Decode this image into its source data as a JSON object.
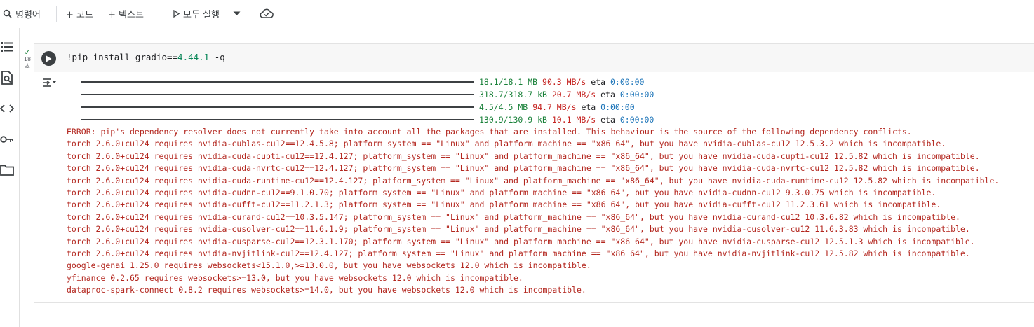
{
  "toolbar": {
    "commands_label": "명령어",
    "add_code_label": "+ 코드",
    "add_text_label": "+ 텍스트",
    "run_all_label": "모두 실행"
  },
  "cell": {
    "exec_time": "18",
    "exec_unit": "초",
    "code_prefix": "!pip install gradio==",
    "code_version": "4.44.1",
    "code_suffix": " -q"
  },
  "progress": [
    {
      "size": "18.1/18.1 MB",
      "rate": "90.3 MB/s",
      "eta_label": "eta",
      "eta": "0:00:00"
    },
    {
      "size": "318.7/318.7 kB",
      "rate": "20.7 MB/s",
      "eta_label": "eta",
      "eta": "0:00:00"
    },
    {
      "size": "4.5/4.5 MB",
      "rate": "94.7 MB/s",
      "eta_label": "eta",
      "eta": "0:00:00"
    },
    {
      "size": "130.9/130.9 kB",
      "rate": "10.1 MB/s",
      "eta_label": "eta",
      "eta": "0:00:00"
    }
  ],
  "output_lines": [
    "ERROR: pip's dependency resolver does not currently take into account all the packages that are installed. This behaviour is the source of the following dependency conflicts.",
    "torch 2.6.0+cu124 requires nvidia-cublas-cu12==12.4.5.8; platform_system == \"Linux\" and platform_machine == \"x86_64\", but you have nvidia-cublas-cu12 12.5.3.2 which is incompatible.",
    "torch 2.6.0+cu124 requires nvidia-cuda-cupti-cu12==12.4.127; platform_system == \"Linux\" and platform_machine == \"x86_64\", but you have nvidia-cuda-cupti-cu12 12.5.82 which is incompatible.",
    "torch 2.6.0+cu124 requires nvidia-cuda-nvrtc-cu12==12.4.127; platform_system == \"Linux\" and platform_machine == \"x86_64\", but you have nvidia-cuda-nvrtc-cu12 12.5.82 which is incompatible.",
    "torch 2.6.0+cu124 requires nvidia-cuda-runtime-cu12==12.4.127; platform_system == \"Linux\" and platform_machine == \"x86_64\", but you have nvidia-cuda-runtime-cu12 12.5.82 which is incompatible.",
    "torch 2.6.0+cu124 requires nvidia-cudnn-cu12==9.1.0.70; platform_system == \"Linux\" and platform_machine == \"x86_64\", but you have nvidia-cudnn-cu12 9.3.0.75 which is incompatible.",
    "torch 2.6.0+cu124 requires nvidia-cufft-cu12==11.2.1.3; platform_system == \"Linux\" and platform_machine == \"x86_64\", but you have nvidia-cufft-cu12 11.2.3.61 which is incompatible.",
    "torch 2.6.0+cu124 requires nvidia-curand-cu12==10.3.5.147; platform_system == \"Linux\" and platform_machine == \"x86_64\", but you have nvidia-curand-cu12 10.3.6.82 which is incompatible.",
    "torch 2.6.0+cu124 requires nvidia-cusolver-cu12==11.6.1.9; platform_system == \"Linux\" and platform_machine == \"x86_64\", but you have nvidia-cusolver-cu12 11.6.3.83 which is incompatible.",
    "torch 2.6.0+cu124 requires nvidia-cusparse-cu12==12.3.1.170; platform_system == \"Linux\" and platform_machine == \"x86_64\", but you have nvidia-cusparse-cu12 12.5.1.3 which is incompatible.",
    "torch 2.6.0+cu124 requires nvidia-nvjitlink-cu12==12.4.127; platform_system == \"Linux\" and platform_machine == \"x86_64\", but you have nvidia-nvjitlink-cu12 12.5.82 which is incompatible.",
    "google-genai 1.25.0 requires websockets<15.1.0,>=13.0.0, but you have websockets 12.0 which is incompatible.",
    "yfinance 0.2.65 requires websockets>=13.0, but you have websockets 12.0 which is incompatible.",
    "dataproc-spark-connect 0.8.2 requires websockets>=14.0, but you have websockets 12.0 which is incompatible."
  ],
  "colors": {
    "error_text": "#b3261e",
    "progress_size": "#188038",
    "progress_eta": "#1a73b8",
    "code_version": "#098658"
  },
  "icons": [
    "search-icon",
    "plus-icon",
    "play-icon",
    "chevron-down-icon",
    "cloud-icon",
    "toc-icon",
    "find-replace-icon",
    "code-brackets-icon",
    "key-icon",
    "folder-icon",
    "check-icon",
    "run-icon",
    "output-toggle-icon"
  ]
}
